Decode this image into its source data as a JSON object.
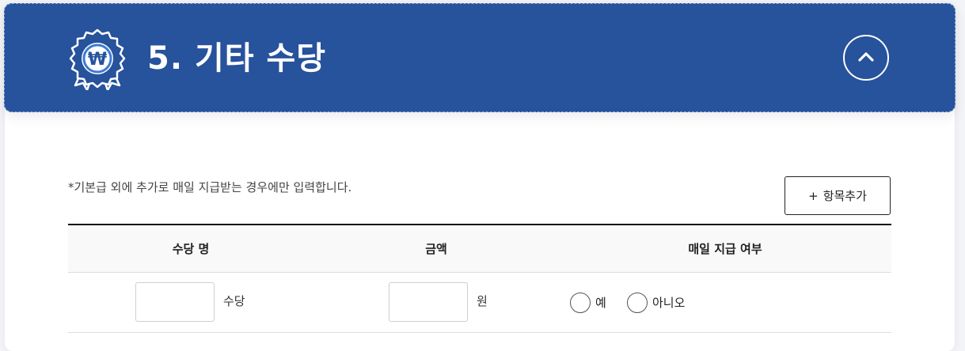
{
  "section": {
    "title": "5. 기타 수당",
    "collapse_icon": "chevron-up-icon",
    "badge_icon": "won-badge-icon",
    "badge_symbol": "₩",
    "header_color": "#27529c"
  },
  "note": "*기본급 외에 추가로 매일 지급받는 경우에만 입력합니다.",
  "add_button": {
    "icon": "+",
    "label": "항목추가"
  },
  "table": {
    "headers": [
      "수당 명",
      "금액",
      "매일 지급 여부"
    ],
    "rows": [
      {
        "name_value": "",
        "name_unit": "수당",
        "amount_value": "",
        "amount_unit": "원",
        "options": [
          "예",
          "아니오"
        ]
      }
    ]
  }
}
